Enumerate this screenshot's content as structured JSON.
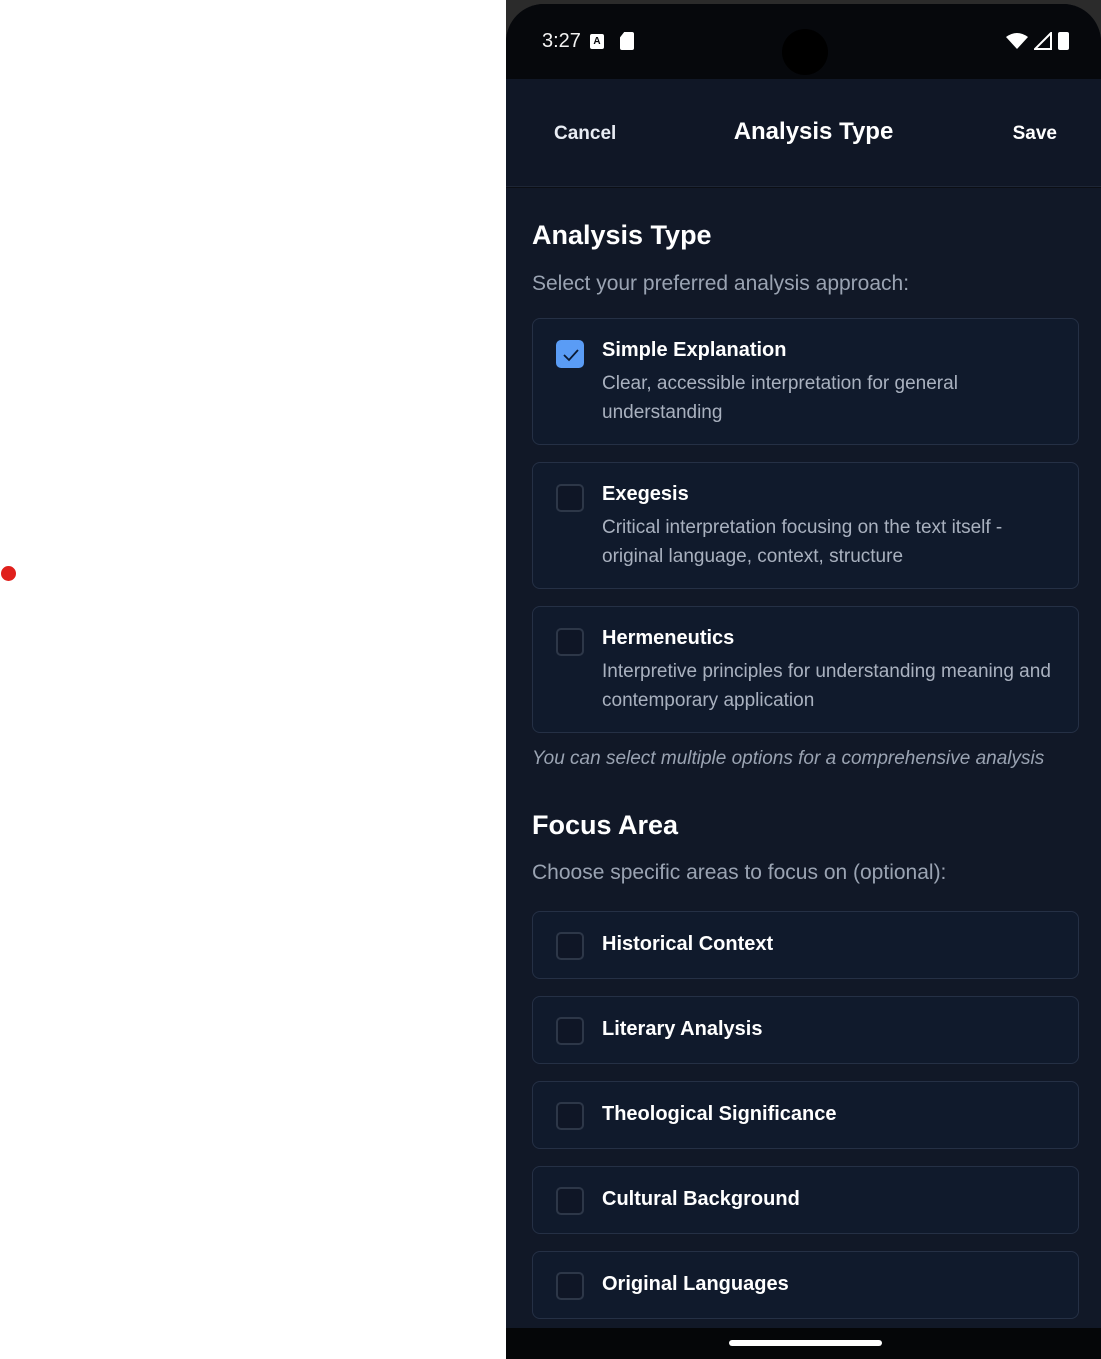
{
  "status_bar": {
    "time": "3:27",
    "icons": [
      "a-notification-icon",
      "sd-card-icon",
      "wifi-icon",
      "signal-icon",
      "battery-icon"
    ]
  },
  "header": {
    "cancel_label": "Cancel",
    "title": "Analysis Type",
    "save_label": "Save"
  },
  "analysis_section": {
    "title": "Analysis Type",
    "subtitle": "Select your preferred analysis approach:",
    "options": [
      {
        "title": "Simple Explanation",
        "description": "Clear, accessible interpretation for general understanding",
        "checked": true
      },
      {
        "title": "Exegesis",
        "description": "Critical interpretation focusing on the text itself - original language, context, structure",
        "checked": false
      },
      {
        "title": "Hermeneutics",
        "description": "Interpretive principles for understanding meaning and contemporary application",
        "checked": false
      }
    ],
    "note": "You can select multiple options for a comprehensive analysis"
  },
  "focus_section": {
    "title": "Focus Area",
    "subtitle": "Choose specific areas to focus on (optional):",
    "options": [
      {
        "title": "Historical Context",
        "checked": false
      },
      {
        "title": "Literary Analysis",
        "checked": false
      },
      {
        "title": "Theological Significance",
        "checked": false
      },
      {
        "title": "Cultural Background",
        "checked": false
      },
      {
        "title": "Original Languages",
        "checked": false
      }
    ]
  },
  "colors": {
    "accent": "#5a9cf5",
    "background": "#111827",
    "card": "#101a2c",
    "header": "#101726"
  }
}
